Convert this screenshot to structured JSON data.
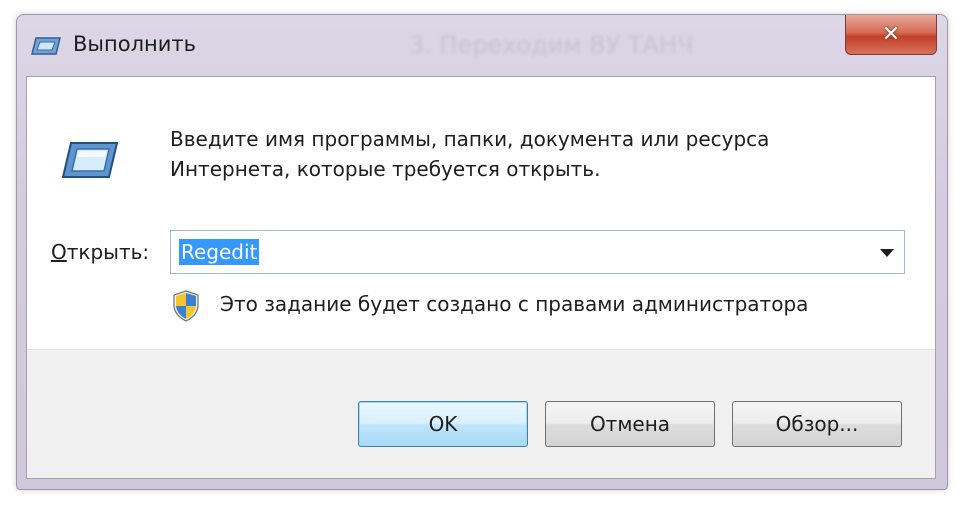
{
  "window": {
    "title": "Выполнить",
    "background_title": "3. Переходим ВУ ТАНЧ",
    "close_symbol": "✕"
  },
  "dialog": {
    "description_line1": "Введите имя программы, папки, документа или ресурса",
    "description_line2": "Интернета, которые требуется открыть.",
    "open_label_underlined": "О",
    "open_label_rest": "ткрыть:",
    "open_value": "Regedit",
    "admin_notice": "Это задание будет создано с правами администратора"
  },
  "buttons": {
    "ok": "OK",
    "cancel": "Отмена",
    "browse": "Обзор..."
  },
  "icons": {
    "title": "run-icon",
    "main": "run-icon",
    "admin": "uac-shield-icon",
    "dropdown": "chevron-down-icon"
  },
  "colors": {
    "selection": "#3399ff",
    "close_button": "#c74a34",
    "ok_border": "#3c7fb1"
  }
}
